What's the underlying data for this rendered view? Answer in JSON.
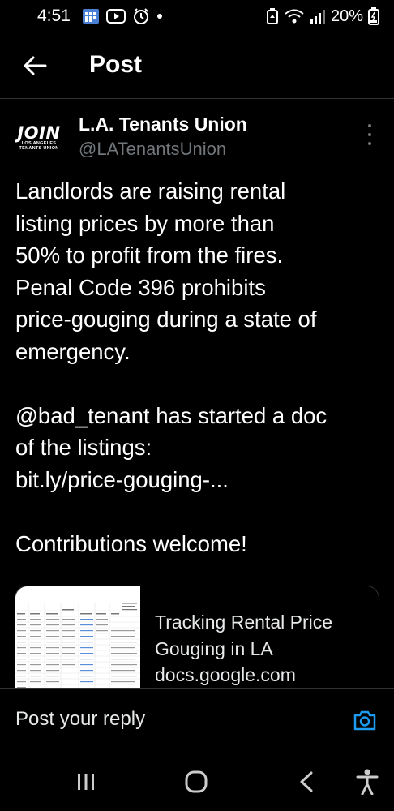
{
  "status_bar": {
    "time": "4:51",
    "battery": "20%"
  },
  "header": {
    "title": "Post"
  },
  "author": {
    "name": "L.A. Tenants Union",
    "handle": "@LATenantsUnion",
    "avatar_text": "JOIN",
    "avatar_subtext_1": "LOS ANGELES",
    "avatar_subtext_2": "TENANTS UNION"
  },
  "post": {
    "paragraph1_lines": [
      "Landlords are raising rental",
      "listing prices by more than",
      "50% to profit from the fires.",
      "Penal Code 396 prohibits",
      "price-gouging during a state of",
      "emergency."
    ],
    "mention": "@bad_tenant",
    "paragraph2_rest": " has started a doc",
    "paragraph2_line2": "of the listings:",
    "link": "bit.ly/price-gouging-...",
    "paragraph3": "Contributions welcome!"
  },
  "link_card": {
    "title": "Tracking Rental Price Gouging in LA",
    "domain": "docs.google.com"
  },
  "reply": {
    "placeholder": "Post your reply"
  },
  "icons": {
    "back": "arrow-left-icon",
    "more": "more-vertical-icon",
    "camera": "camera-icon",
    "accent": "#1d9bf0"
  }
}
